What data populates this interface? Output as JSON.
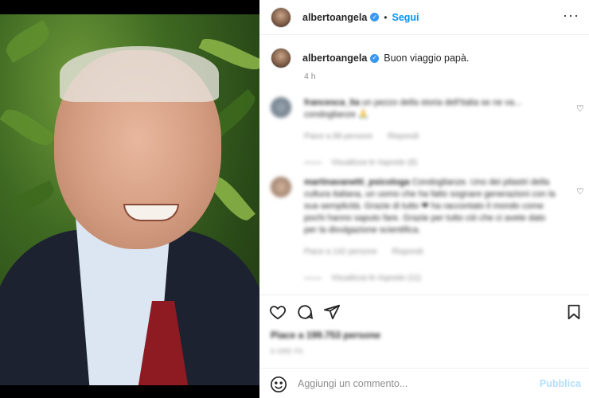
{
  "post": {
    "username": "albertoangela",
    "follow_label": "Segui",
    "separator": "•",
    "more_label": "···",
    "caption": "Buon viaggio papà.",
    "time_ago": "4 h"
  },
  "comments": [
    {
      "username": "francesca_lia",
      "text": "un pezzo della storia dell'Italia se ne va... condoglianze 🙏",
      "meta_likes": "Piace a 88 persone",
      "meta_reply": "Rispondi",
      "replies": "Visualizza le risposte (8)"
    },
    {
      "username": "martinavanetti_psicologa",
      "text": "Condoglianze. Uno dei pilastri della cultura italiana, un uomo che ha fatto sognare generazioni con la sua semplicità. Grazie di tutto ❤ ha raccontato il mondo come pochi hanno saputo fare. Grazie per tutto ciò che ci avete dato per la divulgazione scientifica.",
      "meta_likes": "Piace a 142 persone",
      "meta_reply": "Rispondi",
      "replies": "Visualizza le risposte (11)"
    }
  ],
  "actions": {
    "like_icon": "heart-icon",
    "comment_icon": "comment-icon",
    "share_icon": "share-icon",
    "save_icon": "bookmark-icon",
    "likes_text": "Piace a 199.753 persone",
    "date_text": "6 ORE FA"
  },
  "add_comment": {
    "placeholder": "Aggiungi un commento...",
    "publish_label": "Pubblica"
  },
  "colors": {
    "accent": "#0095f6",
    "verified": "#3897f0",
    "publish_disabled": "#b2dffc"
  }
}
